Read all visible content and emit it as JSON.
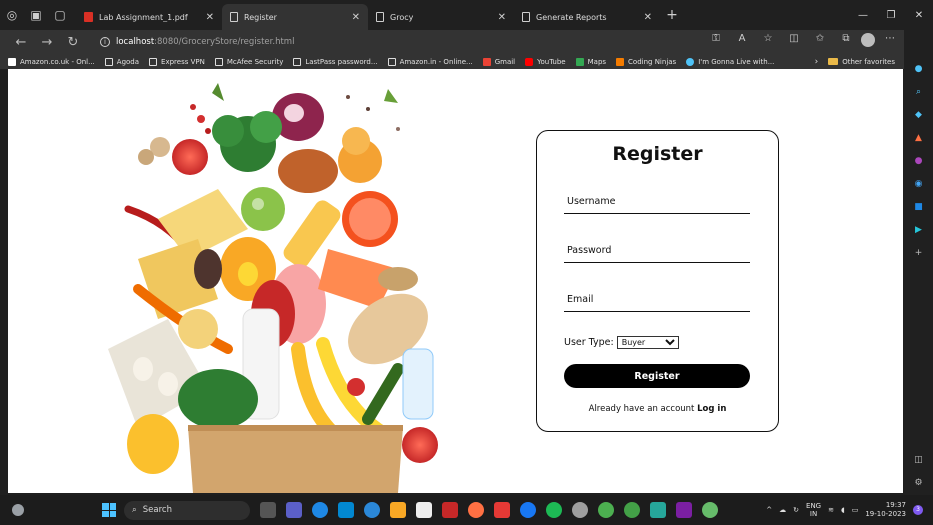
{
  "browser": {
    "tabs": [
      {
        "label": "Lab Assignment_1.pdf",
        "icon": "pdf-icon",
        "active": false
      },
      {
        "label": "Register",
        "icon": "page-icon",
        "active": true
      },
      {
        "label": "Grocy",
        "icon": "page-icon",
        "active": false
      },
      {
        "label": "Generate Reports",
        "icon": "page-icon",
        "active": false
      }
    ],
    "new_tab": "+",
    "address": {
      "host": "localhost",
      "path": ":8080/GroceryStore/register.html"
    },
    "bookmarks": [
      {
        "label": "Amazon.co.uk - Onl...",
        "color": "#ffffff"
      },
      {
        "label": "Agoda",
        "color": "#ffffff"
      },
      {
        "label": "Express VPN",
        "color": "#ffffff"
      },
      {
        "label": "McAfee Security",
        "color": "#ffffff"
      },
      {
        "label": "LastPass password...",
        "color": "#ffffff"
      },
      {
        "label": "Amazon.in - Online...",
        "color": "#ffffff"
      },
      {
        "label": "Gmail",
        "color": "#ea4335"
      },
      {
        "label": "YouTube",
        "color": "#ff0000"
      },
      {
        "label": "Maps",
        "color": "#34a853"
      },
      {
        "label": "Coding Ninjas",
        "color": "#f57c00"
      },
      {
        "label": "I'm Gonna Live with...",
        "color": "#4fc3f7"
      }
    ],
    "other_favorites": "Other favorites"
  },
  "page": {
    "title": "Register",
    "username_placeholder": "Username",
    "password_placeholder": "Password",
    "email_placeholder": "Email",
    "user_type_label": "User Type:",
    "user_type_selected": "Buyer",
    "register_button": "Register",
    "already_text": "Already have an account",
    "login_link": "Log in"
  },
  "taskbar": {
    "search_label": "Search",
    "lang_line1": "ENG",
    "lang_line2": "IN",
    "time": "19:37",
    "date": "19-10-2023",
    "notification_count": "3"
  }
}
